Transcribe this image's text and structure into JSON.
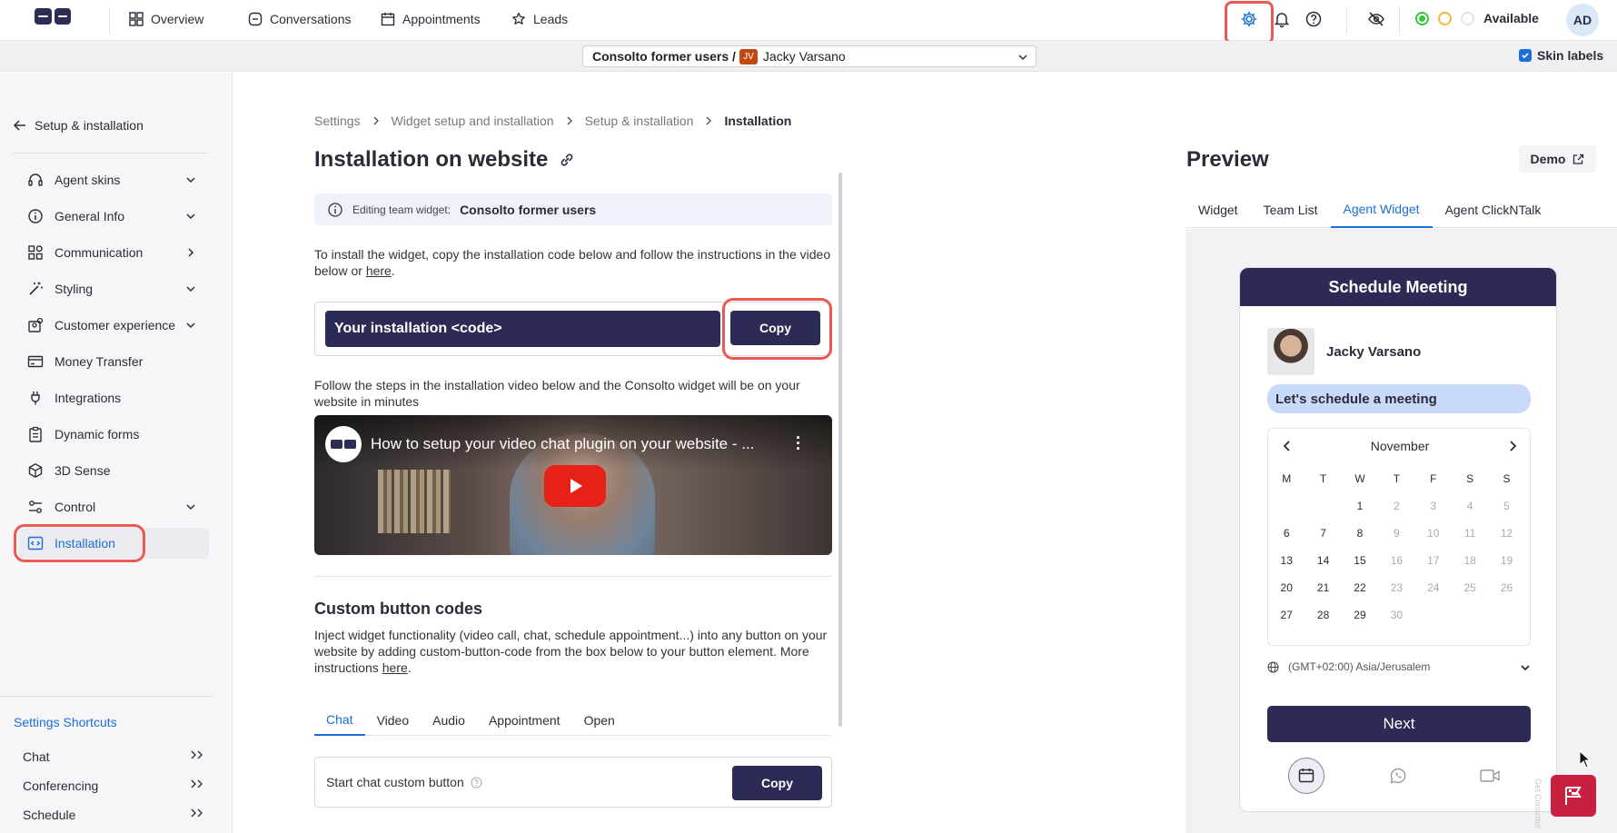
{
  "topbar": {
    "nav": [
      {
        "label": "Overview",
        "icon": "grid-icon"
      },
      {
        "label": "Conversations",
        "icon": "chat-bubble-icon"
      },
      {
        "label": "Appointments",
        "icon": "calendar-icon"
      },
      {
        "label": "Leads",
        "icon": "star-icon"
      }
    ],
    "status_label": "Available",
    "avatar_initials": "AD",
    "status_colors": [
      "#3cc33c",
      "#f0b93a",
      "#e3e3e8"
    ]
  },
  "subbar": {
    "team": "Consolto former users /",
    "agent_initials": "JV",
    "agent_name": "Jacky Varsano",
    "skin_labels": "Skin labels"
  },
  "sidebar": {
    "back_label": "Setup & installation",
    "items": [
      {
        "label": "Agent skins",
        "icon": "headset-icon",
        "chevron": "down"
      },
      {
        "label": "General Info",
        "icon": "info-icon",
        "chevron": "down"
      },
      {
        "label": "Communication",
        "icon": "apps-icon",
        "chevron": "right"
      },
      {
        "label": "Styling",
        "icon": "magic-wand-icon",
        "chevron": "down"
      },
      {
        "label": "Customer experience",
        "icon": "customer-icon",
        "chevron": "down"
      },
      {
        "label": "Money Transfer",
        "icon": "card-icon",
        "chevron": ""
      },
      {
        "label": "Integrations",
        "icon": "plug-icon",
        "chevron": ""
      },
      {
        "label": "Dynamic forms",
        "icon": "clipboard-icon",
        "chevron": ""
      },
      {
        "label": "3D Sense",
        "icon": "cube-icon",
        "chevron": ""
      },
      {
        "label": "Control",
        "icon": "sliders-icon",
        "chevron": "down"
      },
      {
        "label": "Installation",
        "icon": "code-icon",
        "chevron": "",
        "active": true
      }
    ],
    "shortcuts_title": "Settings Shortcuts",
    "shortcuts": [
      "Chat",
      "Conferencing",
      "Schedule"
    ]
  },
  "main": {
    "breadcrumb": [
      "Settings",
      "Widget setup and installation",
      "Setup & installation",
      "Installation"
    ],
    "title": "Installation on website",
    "editing_label": "Editing team widget:",
    "editing_team": "Consolto former users",
    "intro_text": "To install the widget, copy the installation code below and follow the instructions in the video below or",
    "intro_link": "here",
    "code_placeholder": "Your installation <code>",
    "copy_label": "Copy",
    "steps_text": "Follow the steps in the installation video below and the Consolto widget will be on your website in minutes",
    "video_title": "How to setup your video chat plugin on your website - ...",
    "custom_title": "Custom button codes",
    "custom_text": "Inject widget functionality (video call, chat, schedule appointment...) into any button on your website by adding custom-button-code from the box below to your button element. More instructions",
    "custom_link": "here",
    "tabs": [
      "Chat",
      "Video",
      "Audio",
      "Appointment",
      "Open"
    ],
    "active_tab": "Chat",
    "chat_button_label": "Start chat custom button",
    "chat_copy_label": "Copy"
  },
  "preview": {
    "title": "Preview",
    "demo_label": "Demo",
    "tabs": [
      "Widget",
      "Team List",
      "Agent Widget",
      "Agent ClickNTalk"
    ],
    "active_tab": "Agent Widget",
    "widget": {
      "header": "Schedule Meeting",
      "agent_name": "Jacky Varsano",
      "pill": "Let's schedule a meeting",
      "month": "November",
      "weekdays": [
        "M",
        "T",
        "W",
        "T",
        "F",
        "S",
        "S"
      ],
      "weeks": [
        [
          "",
          "",
          "1",
          "2",
          "3",
          "4",
          "5"
        ],
        [
          "6",
          "7",
          "8",
          "9",
          "10",
          "11",
          "12"
        ],
        [
          "13",
          "14",
          "15",
          "16",
          "17",
          "18",
          "19"
        ],
        [
          "20",
          "21",
          "22",
          "23",
          "24",
          "25",
          "26"
        ],
        [
          "27",
          "28",
          "29",
          "30",
          "",
          "",
          ""
        ]
      ],
      "available_days": [
        "1",
        "6",
        "7",
        "8",
        "13",
        "14",
        "15",
        "20",
        "21",
        "22",
        "27",
        "28",
        "29"
      ],
      "timezone": "(GMT+02:00) Asia/Jerusalem",
      "next_label": "Next",
      "vertical_brand": "Get Consolto!"
    }
  },
  "colors": {
    "primary_dark": "#2b2b55",
    "accent_blue": "#1a6fd8",
    "highlight_ring": "#ea5a50",
    "pill_bg": "#c9d9fb"
  }
}
